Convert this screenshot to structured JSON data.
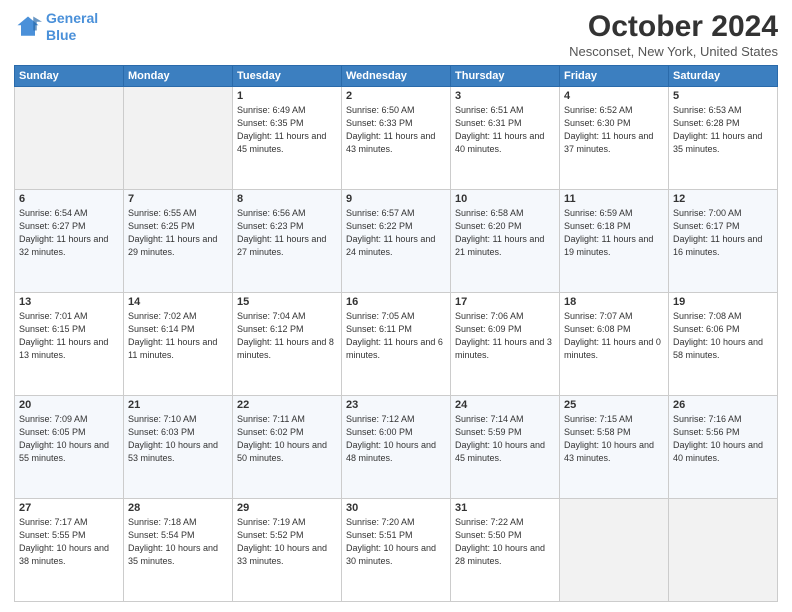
{
  "header": {
    "logo_line1": "General",
    "logo_line2": "Blue",
    "month": "October 2024",
    "location": "Nesconset, New York, United States"
  },
  "weekdays": [
    "Sunday",
    "Monday",
    "Tuesday",
    "Wednesday",
    "Thursday",
    "Friday",
    "Saturday"
  ],
  "weeks": [
    [
      {
        "day": "",
        "info": ""
      },
      {
        "day": "",
        "info": ""
      },
      {
        "day": "1",
        "info": "Sunrise: 6:49 AM\nSunset: 6:35 PM\nDaylight: 11 hours and 45 minutes."
      },
      {
        "day": "2",
        "info": "Sunrise: 6:50 AM\nSunset: 6:33 PM\nDaylight: 11 hours and 43 minutes."
      },
      {
        "day": "3",
        "info": "Sunrise: 6:51 AM\nSunset: 6:31 PM\nDaylight: 11 hours and 40 minutes."
      },
      {
        "day": "4",
        "info": "Sunrise: 6:52 AM\nSunset: 6:30 PM\nDaylight: 11 hours and 37 minutes."
      },
      {
        "day": "5",
        "info": "Sunrise: 6:53 AM\nSunset: 6:28 PM\nDaylight: 11 hours and 35 minutes."
      }
    ],
    [
      {
        "day": "6",
        "info": "Sunrise: 6:54 AM\nSunset: 6:27 PM\nDaylight: 11 hours and 32 minutes."
      },
      {
        "day": "7",
        "info": "Sunrise: 6:55 AM\nSunset: 6:25 PM\nDaylight: 11 hours and 29 minutes."
      },
      {
        "day": "8",
        "info": "Sunrise: 6:56 AM\nSunset: 6:23 PM\nDaylight: 11 hours and 27 minutes."
      },
      {
        "day": "9",
        "info": "Sunrise: 6:57 AM\nSunset: 6:22 PM\nDaylight: 11 hours and 24 minutes."
      },
      {
        "day": "10",
        "info": "Sunrise: 6:58 AM\nSunset: 6:20 PM\nDaylight: 11 hours and 21 minutes."
      },
      {
        "day": "11",
        "info": "Sunrise: 6:59 AM\nSunset: 6:18 PM\nDaylight: 11 hours and 19 minutes."
      },
      {
        "day": "12",
        "info": "Sunrise: 7:00 AM\nSunset: 6:17 PM\nDaylight: 11 hours and 16 minutes."
      }
    ],
    [
      {
        "day": "13",
        "info": "Sunrise: 7:01 AM\nSunset: 6:15 PM\nDaylight: 11 hours and 13 minutes."
      },
      {
        "day": "14",
        "info": "Sunrise: 7:02 AM\nSunset: 6:14 PM\nDaylight: 11 hours and 11 minutes."
      },
      {
        "day": "15",
        "info": "Sunrise: 7:04 AM\nSunset: 6:12 PM\nDaylight: 11 hours and 8 minutes."
      },
      {
        "day": "16",
        "info": "Sunrise: 7:05 AM\nSunset: 6:11 PM\nDaylight: 11 hours and 6 minutes."
      },
      {
        "day": "17",
        "info": "Sunrise: 7:06 AM\nSunset: 6:09 PM\nDaylight: 11 hours and 3 minutes."
      },
      {
        "day": "18",
        "info": "Sunrise: 7:07 AM\nSunset: 6:08 PM\nDaylight: 11 hours and 0 minutes."
      },
      {
        "day": "19",
        "info": "Sunrise: 7:08 AM\nSunset: 6:06 PM\nDaylight: 10 hours and 58 minutes."
      }
    ],
    [
      {
        "day": "20",
        "info": "Sunrise: 7:09 AM\nSunset: 6:05 PM\nDaylight: 10 hours and 55 minutes."
      },
      {
        "day": "21",
        "info": "Sunrise: 7:10 AM\nSunset: 6:03 PM\nDaylight: 10 hours and 53 minutes."
      },
      {
        "day": "22",
        "info": "Sunrise: 7:11 AM\nSunset: 6:02 PM\nDaylight: 10 hours and 50 minutes."
      },
      {
        "day": "23",
        "info": "Sunrise: 7:12 AM\nSunset: 6:00 PM\nDaylight: 10 hours and 48 minutes."
      },
      {
        "day": "24",
        "info": "Sunrise: 7:14 AM\nSunset: 5:59 PM\nDaylight: 10 hours and 45 minutes."
      },
      {
        "day": "25",
        "info": "Sunrise: 7:15 AM\nSunset: 5:58 PM\nDaylight: 10 hours and 43 minutes."
      },
      {
        "day": "26",
        "info": "Sunrise: 7:16 AM\nSunset: 5:56 PM\nDaylight: 10 hours and 40 minutes."
      }
    ],
    [
      {
        "day": "27",
        "info": "Sunrise: 7:17 AM\nSunset: 5:55 PM\nDaylight: 10 hours and 38 minutes."
      },
      {
        "day": "28",
        "info": "Sunrise: 7:18 AM\nSunset: 5:54 PM\nDaylight: 10 hours and 35 minutes."
      },
      {
        "day": "29",
        "info": "Sunrise: 7:19 AM\nSunset: 5:52 PM\nDaylight: 10 hours and 33 minutes."
      },
      {
        "day": "30",
        "info": "Sunrise: 7:20 AM\nSunset: 5:51 PM\nDaylight: 10 hours and 30 minutes."
      },
      {
        "day": "31",
        "info": "Sunrise: 7:22 AM\nSunset: 5:50 PM\nDaylight: 10 hours and 28 minutes."
      },
      {
        "day": "",
        "info": ""
      },
      {
        "day": "",
        "info": ""
      }
    ]
  ]
}
